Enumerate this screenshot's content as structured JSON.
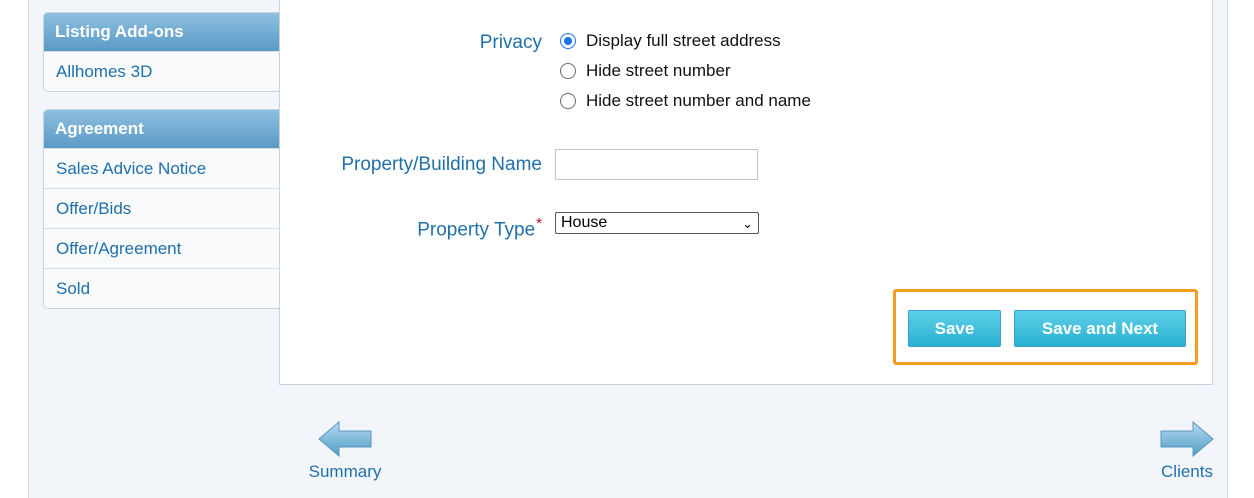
{
  "sidebar": {
    "groups": [
      {
        "header": "Listing Add-ons",
        "items": [
          "Allhomes 3D"
        ]
      },
      {
        "header": "Agreement",
        "items": [
          "Sales Advice Notice",
          "Offer/Bids",
          "Offer/Agreement",
          "Sold"
        ]
      }
    ]
  },
  "form": {
    "privacy": {
      "label": "Privacy",
      "options": [
        "Display full street address",
        "Hide street number",
        "Hide street number and name"
      ],
      "selected_index": 0
    },
    "building_name": {
      "label": "Property/Building Name",
      "value": ""
    },
    "property_type": {
      "label": "Property Type",
      "required_mark": "*",
      "selected": "House",
      "chevron": "⌄"
    }
  },
  "actions": {
    "save_label": "Save",
    "save_next_label": "Save and Next"
  },
  "nav": {
    "prev_label": "Summary",
    "next_label": "Clients"
  },
  "colors": {
    "accent_button": "#29b0d2",
    "highlight": "#f39c1f",
    "link": "#2270a8"
  }
}
